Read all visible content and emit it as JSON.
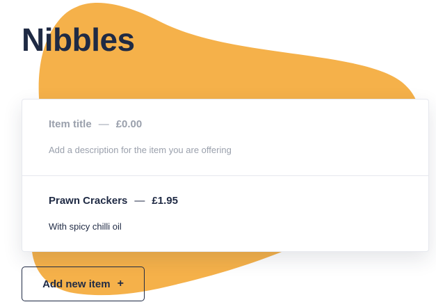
{
  "colors": {
    "blob": "#F5B14A",
    "text": "#1F2A44",
    "placeholder": "#9AA0AC",
    "border": "#E6E8EE"
  },
  "section": {
    "title": "Nibbles"
  },
  "items": [
    {
      "name": "Item title",
      "separator": "—",
      "price": "£0.00",
      "description": "Add a description for the item you are offering"
    },
    {
      "name": "Prawn Crackers",
      "separator": "—",
      "price": "£1.95",
      "description": "With spicy chilli oil"
    }
  ],
  "add_button": {
    "label": "Add new item",
    "icon": "plus-icon",
    "icon_glyph": "+"
  }
}
